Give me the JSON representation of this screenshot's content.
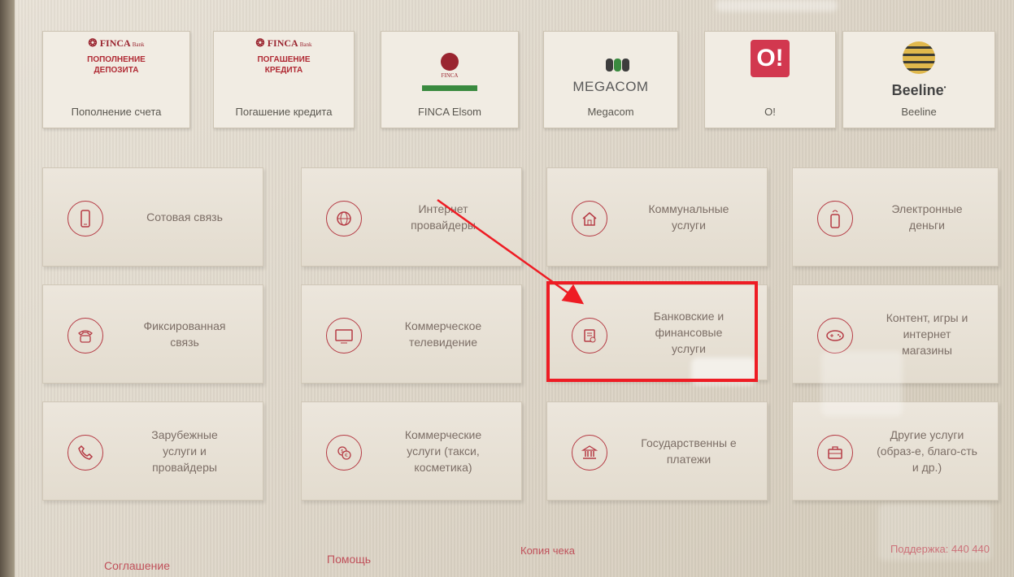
{
  "providers": [
    {
      "logo_brand": "FINCA",
      "logo_bank": "Bank",
      "logo_sub": "ПОПОЛНЕНИЕ ДЕПОЗИТА",
      "caption": "Пополнение счета"
    },
    {
      "logo_brand": "FINCA",
      "logo_bank": "Bank",
      "logo_sub": "ПОГАШЕНИЕ КРЕДИТА",
      "caption": "Погашение кредита"
    },
    {
      "logo_brand": "FINCA",
      "caption": "FINCA Elsom"
    },
    {
      "logo": "MEGACOM",
      "caption": "Megacom"
    },
    {
      "logo": "O!",
      "caption": "O!"
    },
    {
      "logo": "Beeline",
      "caption": "Beeline"
    }
  ],
  "categories": [
    {
      "label": "Сотовая связь",
      "icon": "mobile-phone-icon"
    },
    {
      "label": "Интернет провайдеры",
      "icon": "globe-icon"
    },
    {
      "label": "Коммунальные услуги",
      "icon": "house-icon"
    },
    {
      "label": "Электронные деньги",
      "icon": "e-wallet-icon"
    },
    {
      "label": "Фиксированная связь",
      "icon": "landline-phone-icon"
    },
    {
      "label": "Коммерческое телевидение",
      "icon": "tv-icon"
    },
    {
      "label": "Банковские и финансовые услуги",
      "icon": "bank-card-icon"
    },
    {
      "label": "Контент, игры и интернет магазины",
      "icon": "game-controller-icon"
    },
    {
      "label": "Зарубежные услуги и провайдеры",
      "icon": "handset-icon"
    },
    {
      "label": "Коммерческие услуги (такси, косметика)",
      "icon": "money-icon"
    },
    {
      "label": "Государственны е платежи",
      "icon": "government-building-icon"
    },
    {
      "label": "Другие услуги (образ-е, благо-сть и др.)",
      "icon": "briefcase-icon"
    }
  ],
  "footer": {
    "agreement": "Соглашение",
    "help": "Помощь",
    "receipt_copy": "Копия чека",
    "support": "Поддержка: 440 440"
  },
  "colors": {
    "accent": "#b53a44",
    "highlight_box": "#ee1c24"
  }
}
